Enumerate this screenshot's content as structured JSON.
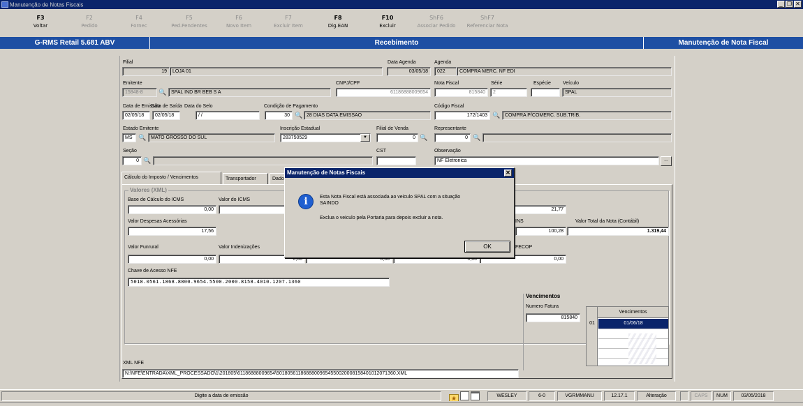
{
  "window": {
    "title": "Manutenção de Notas Fiscais"
  },
  "fkeys": [
    {
      "key": "F3",
      "label": "Voltar",
      "enabled": true
    },
    {
      "key": "F2",
      "label": "Pedido",
      "enabled": false
    },
    {
      "key": "F4",
      "label": "Fornec",
      "enabled": false
    },
    {
      "key": "F5",
      "label": "Ped.Pendentes",
      "enabled": false
    },
    {
      "key": "F6",
      "label": "Novo Item",
      "enabled": false
    },
    {
      "key": "F7",
      "label": "Excluir Item",
      "enabled": false
    },
    {
      "key": "F8",
      "label": "Dig.EAN",
      "enabled": true
    },
    {
      "key": "F10",
      "label": "Excluir",
      "enabled": true
    },
    {
      "key": "ShF6",
      "label": "Associar Pedido",
      "enabled": false
    },
    {
      "key": "ShF7",
      "label": "Referenciar Nota",
      "enabled": false
    }
  ],
  "header": {
    "left": "G-RMS Retail 5.681 ABV",
    "center": "Recebimento",
    "right": "Manutenção de Nota Fiscal"
  },
  "form": {
    "filial": {
      "label": "Filial",
      "code": "19",
      "name": "LOJA 01"
    },
    "data_agenda": {
      "label": "Data Agenda",
      "value": "03/05/18"
    },
    "agenda": {
      "label": "Agenda",
      "code": "022",
      "desc": "COMPRA MERC. NF EDI"
    },
    "emitente": {
      "label": "Emitente",
      "code": "15848-8",
      "name": "SPAL IND BR BEB S A"
    },
    "cnpj": {
      "label": "CNPJ/CPF",
      "value": "61186888009654"
    },
    "nota_fiscal": {
      "label": "Nota Fiscal",
      "value": "815840"
    },
    "serie": {
      "label": "Série",
      "value": "2"
    },
    "especie": {
      "label": "Espécie",
      "value": ""
    },
    "veiculo": {
      "label": "Veículo",
      "value": "SPAL"
    },
    "data_emissao": {
      "label": "Data de Emissão",
      "value": "02/05/18"
    },
    "data_saida": {
      "label": "Data de Saída",
      "value": "02/05/18"
    },
    "data_selo": {
      "label": "Data do Selo",
      "value": "/ /"
    },
    "cond_pagamento": {
      "label": "Condição de Pagamento",
      "code": "30",
      "desc": "28 DIAS DATA EMISSAO"
    },
    "codigo_fiscal": {
      "label": "Código Fiscal",
      "code": "172/1403",
      "desc": "COMPRA P/COMERC. SUB.TRIB."
    },
    "estado_emitente": {
      "label": "Estado Emitente",
      "uf": "MS",
      "name": "MATO GROSSO DO SUL"
    },
    "inscricao_estadual": {
      "label": "Inscrição Estadual",
      "value": "283750529"
    },
    "filial_venda": {
      "label": "Filial de Venda",
      "value": "0"
    },
    "representante": {
      "label": "Representante",
      "value": "0"
    },
    "secao": {
      "label": "Seção",
      "value": "0"
    },
    "cst": {
      "label": "CST",
      "value": ""
    },
    "observacao": {
      "label": "Observação",
      "value": "NF Eletronica"
    },
    "ellipsis": "..."
  },
  "tabs": [
    "Cálculo do Imposto / Vencimentos",
    "Transportador",
    "Dado"
  ],
  "valores": {
    "group_title": "Valores (XML)",
    "base_icms_label": "Base de Cálculo do ICMS",
    "base_icms": "0,00",
    "valor_icms_label": "Valor do ICMS",
    "valor_despesas_label": "Valor Despesas Acessórias",
    "valor_despesas": "17,56",
    "valor_funrural_label": "Valor Funrural",
    "valor_funrural": "0,00",
    "valor_indenizacoes_label": "Valor Indenizações",
    "v_21": "21,77",
    "ins_label": "INS",
    "ins_value": "100,28",
    "total_label": "Valor Total da Nota (Contábil)",
    "total_value": "1.319,44",
    "fecop_label": "FECOP",
    "fecop_value": "0,00",
    "z1": "0,00",
    "z2": "0,00",
    "z3": "0,00",
    "chave_label": "Chave de Acesso NFE",
    "chave_value": "5018.0561.1868.8800.9654.5500.2000.8158.4010.1207.1360"
  },
  "xml": {
    "label": "XML NFE",
    "path": "N:\\NFE\\ENTRADA\\XML_PROCESSADO\\1\\201805\\61186888009654\\50180561186888009654550020008158401012071360.XML"
  },
  "vencimentos": {
    "title": "Vencimentos",
    "numero_fatura_label": "Numero Fatura",
    "numero_fatura": "815840",
    "grid_header": "Vencimentos",
    "rows": [
      {
        "n": "01",
        "date": "01/06/18"
      }
    ]
  },
  "dialog": {
    "title": "Manutenção de Notas Fiscais",
    "line1": "Esta Nota Fiscal está associada ao veiculo SPAL    com a situação",
    "line2": "SAINDO",
    "line3": "Exclua o veiculo pela Portaria para depois excluir a nota.",
    "ok": "OK",
    "close": "✕"
  },
  "status": {
    "message": "Digite a data de emissão",
    "user": "WESLEY",
    "code": "6-0",
    "program": "VGRMMANU",
    "version": "12.17.1",
    "mode": "Alteração",
    "caps": "CAPS",
    "num": "NUM",
    "date": "03/05/2018"
  }
}
